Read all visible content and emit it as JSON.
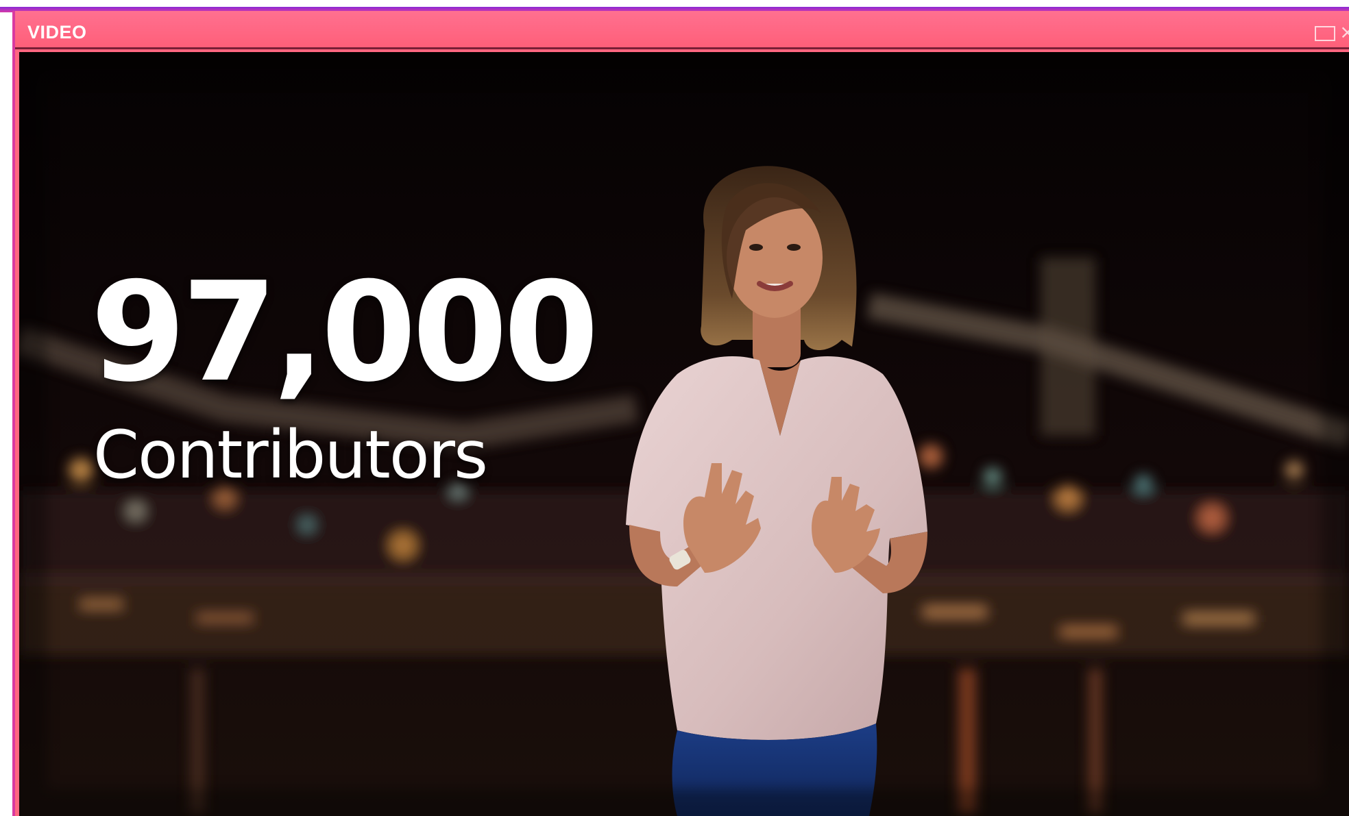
{
  "window": {
    "title": "VIDEO",
    "controls": [
      "maximize-icon",
      "close-icon"
    ],
    "title_bar_color": "#ff6680"
  },
  "video": {
    "overlay_number": "97,000",
    "overlay_label": "Contributors",
    "background_color": "#070404"
  }
}
